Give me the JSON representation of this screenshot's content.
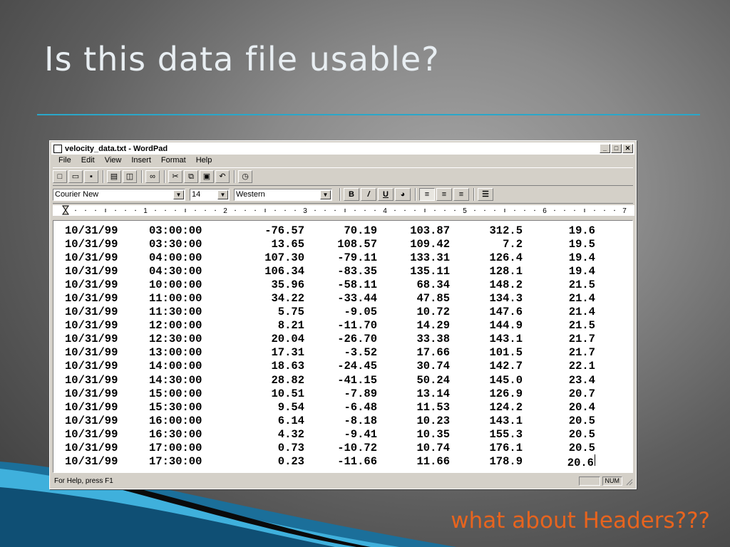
{
  "slide": {
    "title": "Is this data file usable?",
    "caption": "what about Headers???"
  },
  "window": {
    "title": "velocity_data.txt - WordPad",
    "controls": {
      "minimize": "_",
      "maximize": "□",
      "close": "✕"
    },
    "menu": [
      "File",
      "Edit",
      "View",
      "Insert",
      "Format",
      "Help"
    ],
    "format": {
      "font": "Courier New",
      "size": "14",
      "script": "Western",
      "bold_label": "B",
      "underline_label": "U"
    },
    "ruler_numbers": [
      "1",
      "2",
      "3",
      "4",
      "5",
      "6",
      "7"
    ],
    "status": {
      "help_text": "For Help, press F1",
      "num_lock": "NUM"
    }
  },
  "document": {
    "rows": [
      [
        "10/31/99",
        "03:00:00",
        "-76.57",
        "70.19",
        "103.87",
        "312.5",
        "19.6"
      ],
      [
        "10/31/99",
        "03:30:00",
        "13.65",
        "108.57",
        "109.42",
        "7.2",
        "19.5"
      ],
      [
        "10/31/99",
        "04:00:00",
        "107.30",
        "-79.11",
        "133.31",
        "126.4",
        "19.4"
      ],
      [
        "10/31/99",
        "04:30:00",
        "106.34",
        "-83.35",
        "135.11",
        "128.1",
        "19.4"
      ],
      [
        "10/31/99",
        "10:00:00",
        "35.96",
        "-58.11",
        "68.34",
        "148.2",
        "21.5"
      ],
      [
        "10/31/99",
        "11:00:00",
        "34.22",
        "-33.44",
        "47.85",
        "134.3",
        "21.4"
      ],
      [
        "10/31/99",
        "11:30:00",
        "5.75",
        "-9.05",
        "10.72",
        "147.6",
        "21.4"
      ],
      [
        "10/31/99",
        "12:00:00",
        "8.21",
        "-11.70",
        "14.29",
        "144.9",
        "21.5"
      ],
      [
        "10/31/99",
        "12:30:00",
        "20.04",
        "-26.70",
        "33.38",
        "143.1",
        "21.7"
      ],
      [
        "10/31/99",
        "13:00:00",
        "17.31",
        "-3.52",
        "17.66",
        "101.5",
        "21.7"
      ],
      [
        "10/31/99",
        "14:00:00",
        "18.63",
        "-24.45",
        "30.74",
        "142.7",
        "22.1"
      ],
      [
        "10/31/99",
        "14:30:00",
        "28.82",
        "-41.15",
        "50.24",
        "145.0",
        "23.4"
      ],
      [
        "10/31/99",
        "15:00:00",
        "10.51",
        "-7.89",
        "13.14",
        "126.9",
        "20.7"
      ],
      [
        "10/31/99",
        "15:30:00",
        "9.54",
        "-6.48",
        "11.53",
        "124.2",
        "20.4"
      ],
      [
        "10/31/99",
        "16:00:00",
        "6.14",
        "-8.18",
        "10.23",
        "143.1",
        "20.5"
      ],
      [
        "10/31/99",
        "16:30:00",
        "4.32",
        "-9.41",
        "10.35",
        "155.3",
        "20.5"
      ],
      [
        "10/31/99",
        "17:00:00",
        "0.73",
        "-10.72",
        "10.74",
        "176.1",
        "20.5"
      ],
      [
        "10/31/99",
        "17:30:00",
        "0.23",
        "-11.66",
        "11.66",
        "178.9",
        "20.6"
      ]
    ]
  },
  "colors": {
    "title_rule": "#2aa7c9",
    "caption": "#e8641e",
    "accent_swoosh": "#1f9ad0"
  }
}
